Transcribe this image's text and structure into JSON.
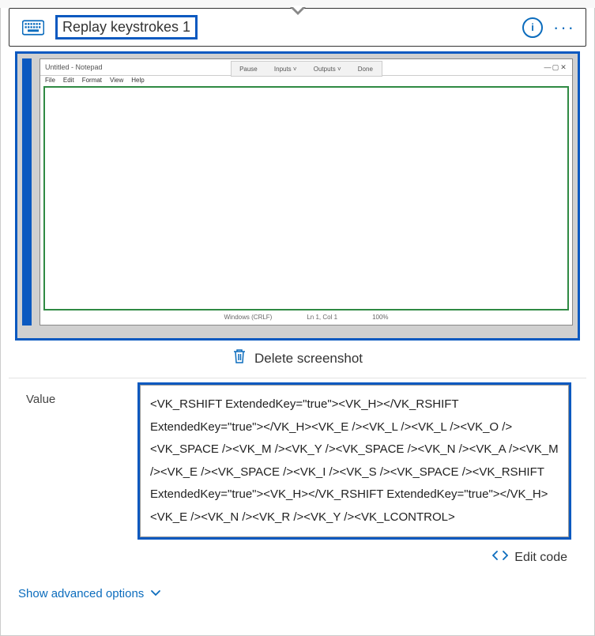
{
  "header": {
    "title": "Replay keystrokes 1",
    "info_tooltip": "i",
    "more_label": "···"
  },
  "screenshot": {
    "window_title": "Untitled - Notepad",
    "menu_items": [
      "File",
      "Edit",
      "Format",
      "View",
      "Help"
    ],
    "float_items": [
      "Pause",
      "Inputs  ˅",
      "Outputs  ˅",
      "Done"
    ],
    "status_items": [
      "Windows (CRLF)",
      "Ln 1, Col 1",
      "100%"
    ],
    "delete_label": "Delete screenshot"
  },
  "value_field": {
    "label": "Value",
    "content": "<VK_RSHIFT ExtendedKey=\"true\"><VK_H></VK_RSHIFT ExtendedKey=\"true\"></VK_H><VK_E /><VK_L /><VK_L /><VK_O /><VK_SPACE /><VK_M /><VK_Y /><VK_SPACE /><VK_N /><VK_A /><VK_M /><VK_E /><VK_SPACE /><VK_I /><VK_S /><VK_SPACE /><VK_RSHIFT ExtendedKey=\"true\"><VK_H></VK_RSHIFT ExtendedKey=\"true\"></VK_H><VK_E /><VK_N /><VK_R /><VK_Y /><VK_LCONTROL>"
  },
  "actions": {
    "edit_code_label": "Edit code",
    "advanced_label": "Show advanced options"
  }
}
